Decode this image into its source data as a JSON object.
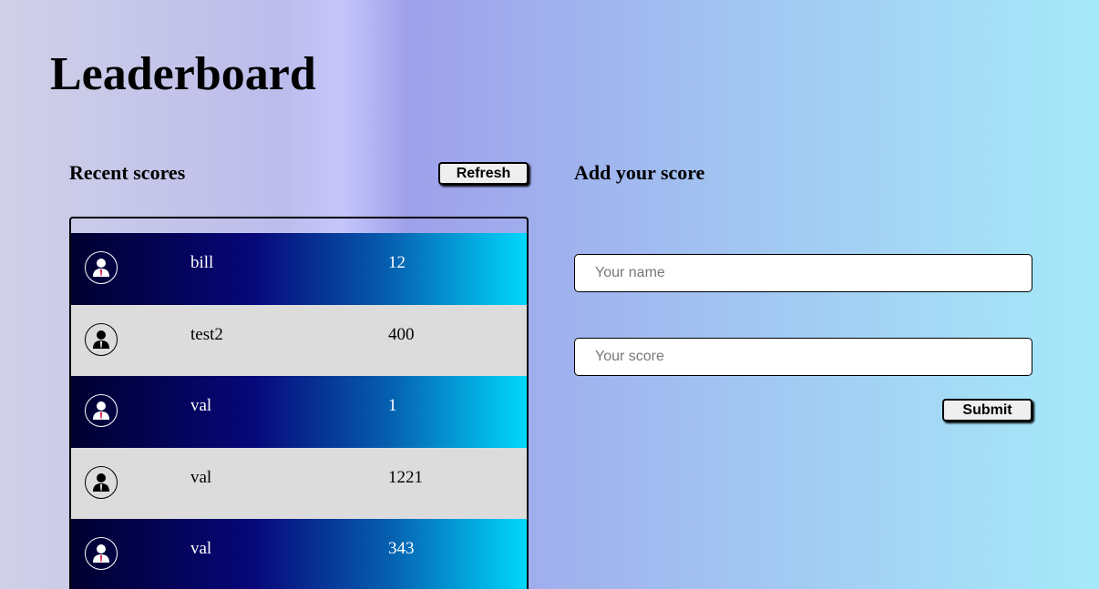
{
  "title": "Leaderboard",
  "recent": {
    "heading": "Recent scores",
    "refresh_label": "Refresh",
    "rows": [
      {
        "name": "bill",
        "score": "12",
        "style": "dark"
      },
      {
        "name": "test2",
        "score": "400",
        "style": "light"
      },
      {
        "name": "val",
        "score": "1",
        "style": "dark"
      },
      {
        "name": "val",
        "score": "1221",
        "style": "light"
      },
      {
        "name": "val",
        "score": "343",
        "style": "dark"
      }
    ]
  },
  "add": {
    "heading": "Add your score",
    "name_placeholder": "Your name",
    "score_placeholder": "Your score",
    "submit_label": "Submit"
  }
}
